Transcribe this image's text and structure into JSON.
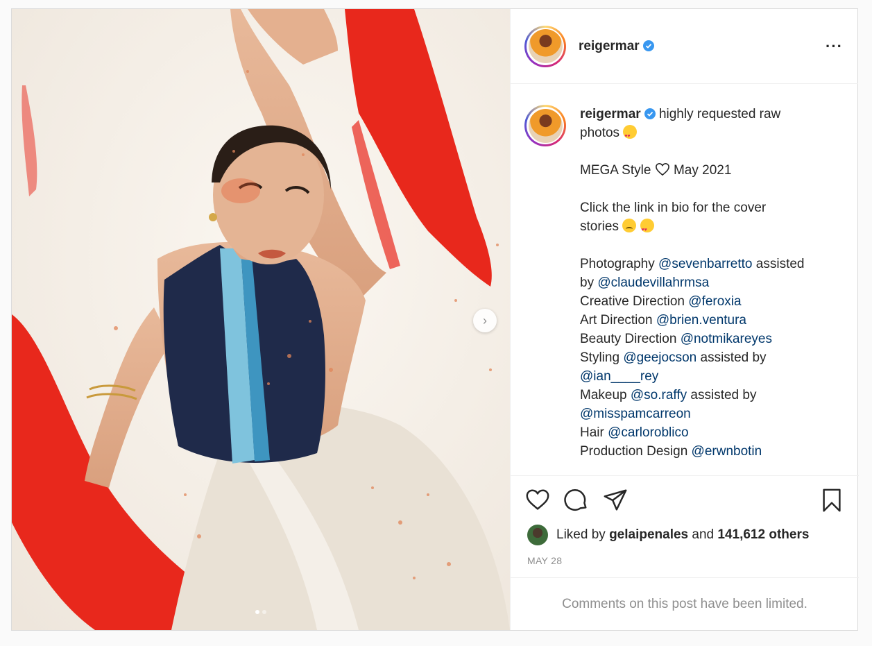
{
  "post": {
    "username": "reigermar",
    "more_icon": "more-horizontal-icon",
    "verified_icon": "verified-badge-icon"
  },
  "caption": {
    "username": "reigermar",
    "line1": "highly requested raw",
    "line2": "photos",
    "mega_prefix": "MEGA Style",
    "mega_suffix": "May 2021",
    "link_line1": "Click the link in bio for the cover",
    "link_line2": "stories",
    "credits": [
      {
        "role": "Photography",
        "mention": "@sevenbarretto",
        "after": "assisted"
      },
      {
        "role": "by",
        "mention": "@claudevillahrmsa",
        "after": ""
      },
      {
        "role": "Creative Direction",
        "mention": "@feroxia",
        "after": ""
      },
      {
        "role": "Art Direction",
        "mention": "@brien.ventura",
        "after": ""
      },
      {
        "role": "Beauty Direction",
        "mention": "@notmikareyes",
        "after": ""
      },
      {
        "role": "Styling",
        "mention": "@geejocson",
        "after": "assisted by"
      },
      {
        "role": "",
        "mention": "@ian____rey",
        "after": ""
      },
      {
        "role": "Makeup",
        "mention": "@so.raffy",
        "after": "assisted by"
      },
      {
        "role": "",
        "mention": "@misspamcarreon",
        "after": ""
      },
      {
        "role": "Hair",
        "mention": "@carloroblico",
        "after": ""
      },
      {
        "role": "Production Design",
        "mention": "@erwnbotin",
        "after": ""
      }
    ]
  },
  "actions": {
    "like_icon": "heart-icon",
    "comment_icon": "comment-icon",
    "share_icon": "send-icon",
    "save_icon": "bookmark-icon"
  },
  "likes": {
    "prefix": "Liked by",
    "user": "gelaipenales",
    "joiner": "and",
    "count": "141,612 others"
  },
  "date": "MAY 28",
  "comments_notice": "Comments on this post have been limited.",
  "carousel": {
    "next_icon": "chevron-right-icon",
    "current_slide": 1,
    "total_slides": 2
  }
}
